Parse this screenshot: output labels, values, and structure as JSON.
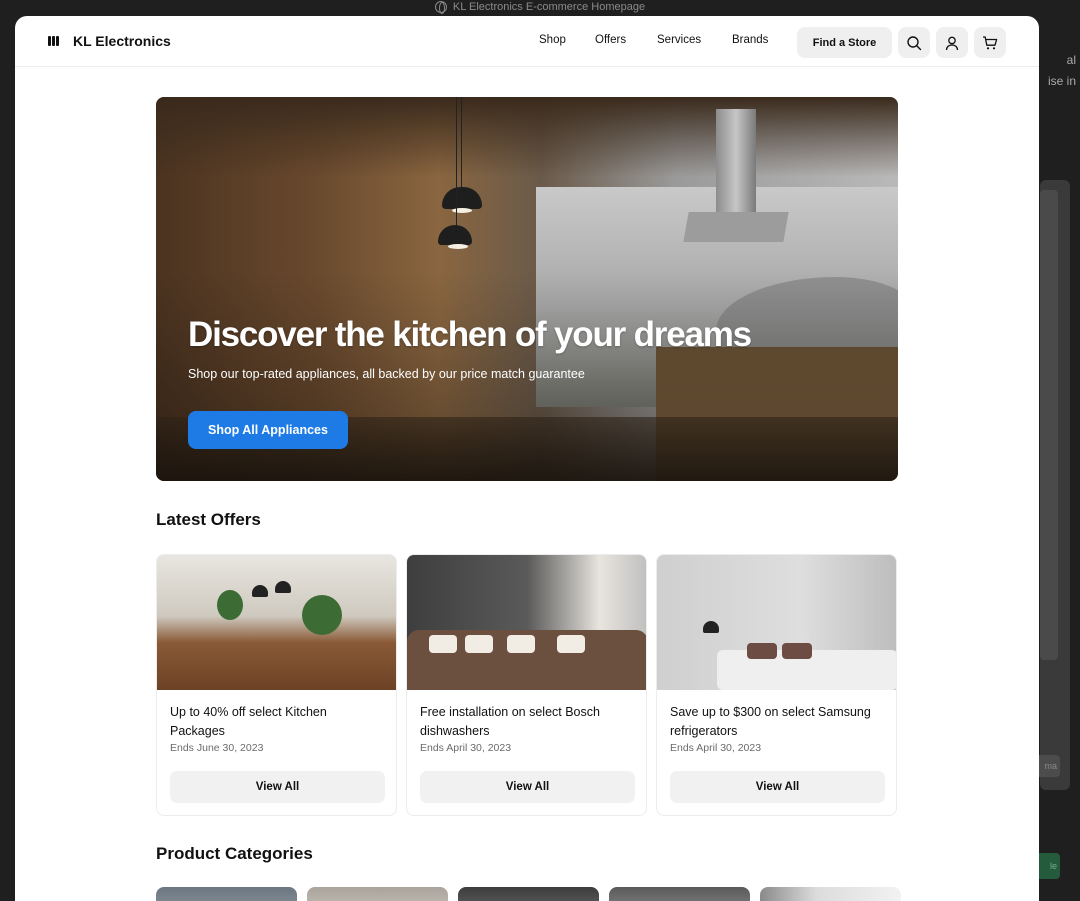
{
  "browser": {
    "title": "KL Electronics E-commerce Homepage"
  },
  "background": {
    "right_text_1": "al",
    "right_text_2": "ise in",
    "chip": "ma",
    "green_chip": "le"
  },
  "nav": {
    "brand": "KL Electronics",
    "menu": [
      "Shop",
      "Offers",
      "Services",
      "Brands"
    ],
    "find_store": "Find a Store",
    "icons": [
      "search-icon",
      "user-icon",
      "cart-icon"
    ]
  },
  "hero": {
    "title": "Discover the kitchen of your dreams",
    "subtitle": "Shop our top-rated appliances, all backed by our price match guarantee",
    "cta": "Shop All Appliances"
  },
  "offers": {
    "title": "Latest Offers",
    "items": [
      {
        "text": "Up to 40% off select Kitchen Packages",
        "date": "Ends June 30, 2023",
        "button": "View All"
      },
      {
        "text": "Free installation on select Bosch dishwashers",
        "date": "Ends April 30, 2023",
        "button": "View All"
      },
      {
        "text": "Save up to $300 on select Samsung refrigerators",
        "date": "Ends April 30, 2023",
        "button": "View All"
      }
    ]
  },
  "categories": {
    "title": "Product Categories"
  },
  "colors": {
    "accent": "#1e7be5",
    "button_bg": "#efefef",
    "text": "#111111",
    "muted": "#6b6b6b"
  }
}
